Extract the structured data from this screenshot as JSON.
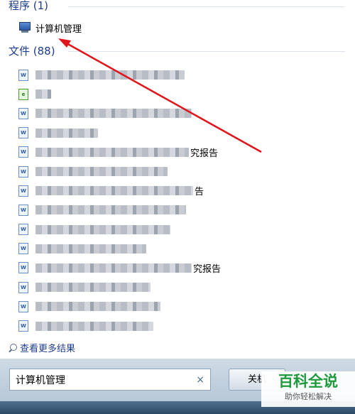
{
  "programs": {
    "header": "程序 (1)",
    "items": [
      {
        "label": "计算机管理",
        "icon": "computer-management-icon"
      }
    ]
  },
  "files": {
    "header": "文件 (88)",
    "items": [
      {
        "suffix": "",
        "icon": "word-doc-icon"
      },
      {
        "suffix": "",
        "icon": "green-file-icon"
      },
      {
        "suffix": "",
        "icon": "word-doc-icon"
      },
      {
        "suffix": "",
        "icon": "word-doc-icon"
      },
      {
        "suffix": "究报告",
        "icon": "word-doc-icon"
      },
      {
        "suffix": "",
        "icon": "word-doc-icon"
      },
      {
        "suffix": "告",
        "icon": "word-doc-icon"
      },
      {
        "suffix": "",
        "icon": "word-doc-icon"
      },
      {
        "suffix": "",
        "icon": "word-doc-icon"
      },
      {
        "suffix": "",
        "icon": "word-doc-icon"
      },
      {
        "suffix": "究报告",
        "icon": "word-doc-icon"
      },
      {
        "suffix": "",
        "icon": "word-doc-icon"
      },
      {
        "suffix": "",
        "icon": "word-doc-icon"
      },
      {
        "suffix": "",
        "icon": "word-doc-icon"
      }
    ]
  },
  "more_results": "查看更多结果",
  "search": {
    "value": "计算机管理",
    "clear": "×"
  },
  "shutdown_label": "关机",
  "watermark": {
    "title": "百科全说",
    "subtitle": "助你轻松解决"
  },
  "colors": {
    "annotation_arrow": "#e0151c",
    "link": "#1e3c8a"
  }
}
